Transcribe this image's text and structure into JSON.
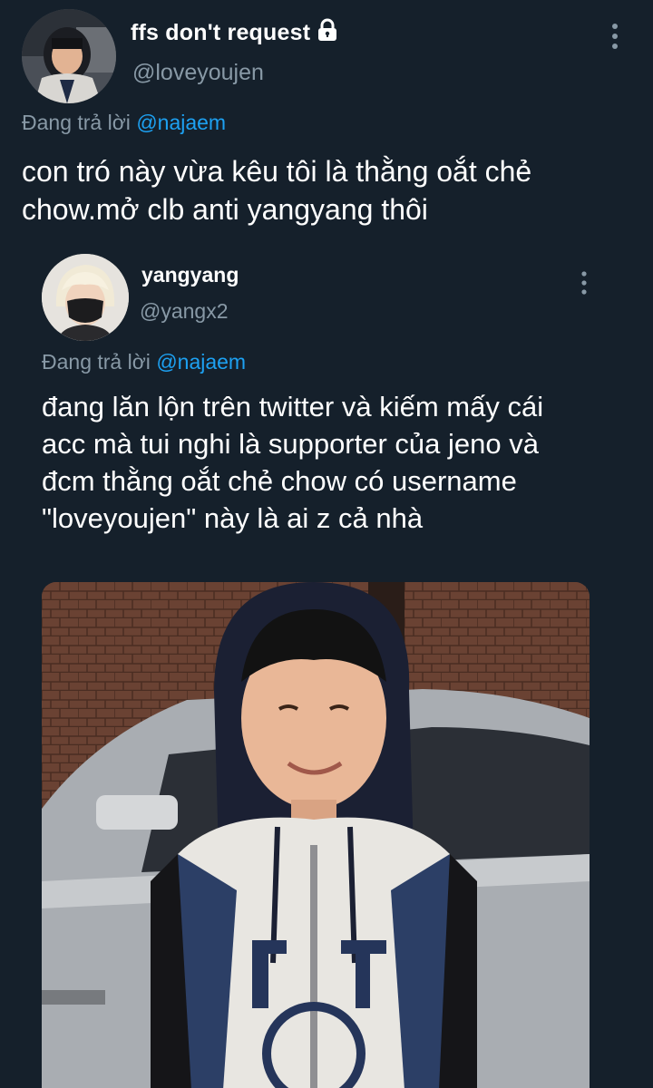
{
  "tweet": {
    "display_name": "ffs don't request",
    "handle": "@loveyoujen",
    "reply_prefix": "Đang trả lời",
    "reply_to": "@najaem",
    "text_lines": [
      "con tró này vừa kêu tôi là thằng oắt chẻ",
      "chow.mở clb anti yangyang thôi"
    ],
    "icons": {
      "lock": "lock-icon",
      "more": "more-vertical-icon"
    }
  },
  "quoted_tweet": {
    "display_name": "yangyang",
    "handle": "@yangx2",
    "reply_prefix": "Đang trả lời",
    "reply_to": "@najaem",
    "text_lines": [
      "đang lăn lộn trên twitter và kiếm mấy cái",
      "acc mà tui nghi là supporter của jeno và",
      "đcm thằng oắt chẻ chow có username",
      "\"loveyoujen\" này là ai z cả nhà"
    ],
    "icons": {
      "more": "more-vertical-icon"
    }
  },
  "colors": {
    "background": "#15202b",
    "text": "#ffffff",
    "secondary_text": "#8899a6",
    "link": "#1da1f2"
  }
}
